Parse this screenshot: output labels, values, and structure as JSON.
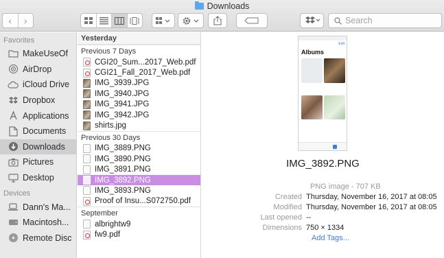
{
  "window": {
    "title": "Downloads"
  },
  "toolbar": {
    "back_icon": "chevron-left-icon",
    "forward_icon": "chevron-right-icon",
    "views": [
      "icon-view",
      "list-view",
      "column-view",
      "cover-flow-view"
    ],
    "active_view": "column-view",
    "search_placeholder": "Search"
  },
  "sidebar": {
    "favorites_heading": "Favorites",
    "favorites": [
      {
        "label": "MakeUseOf",
        "icon": "folder-icon"
      },
      {
        "label": "AirDrop",
        "icon": "airdrop-icon"
      },
      {
        "label": "iCloud Drive",
        "icon": "cloud-icon"
      },
      {
        "label": "Dropbox",
        "icon": "dropbox-icon"
      },
      {
        "label": "Applications",
        "icon": "applications-icon"
      },
      {
        "label": "Documents",
        "icon": "documents-icon"
      },
      {
        "label": "Downloads",
        "icon": "downloads-icon",
        "selected": true
      },
      {
        "label": "Pictures",
        "icon": "camera-icon"
      },
      {
        "label": "Desktop",
        "icon": "desktop-icon"
      }
    ],
    "devices_heading": "Devices",
    "devices": [
      {
        "label": "Dann's Ma...",
        "icon": "laptop-icon"
      },
      {
        "label": "Macintosh...",
        "icon": "disk-icon"
      },
      {
        "label": "Remote Disc",
        "icon": "disc-icon"
      }
    ]
  },
  "list": {
    "groups": [
      {
        "title": "Yesterday",
        "items": []
      },
      {
        "title": "Previous 7 Days",
        "items": [
          {
            "name": "CGI20_Sum...2017_Web.pdf",
            "kind": "pdf"
          },
          {
            "name": "CGI21_Fall_2017_Web.pdf",
            "kind": "pdf"
          },
          {
            "name": "IMG_3939.JPG",
            "kind": "img"
          },
          {
            "name": "IMG_3940.JPG",
            "kind": "img"
          },
          {
            "name": "IMG_3941.JPG",
            "kind": "img"
          },
          {
            "name": "IMG_3942.JPG",
            "kind": "img"
          },
          {
            "name": "shirts.jpg",
            "kind": "img"
          }
        ]
      },
      {
        "title": "Previous 30 Days",
        "items": [
          {
            "name": "IMG_3889.PNG",
            "kind": "doc"
          },
          {
            "name": "IMG_3890.PNG",
            "kind": "doc"
          },
          {
            "name": "IMG_3891.PNG",
            "kind": "doc"
          },
          {
            "name": "IMG_3892.PNG",
            "kind": "doc",
            "selected": true
          },
          {
            "name": "IMG_3893.PNG",
            "kind": "doc"
          },
          {
            "name": "Proof of Insu...S072750.pdf",
            "kind": "pdf"
          }
        ]
      },
      {
        "title": "September",
        "items": [
          {
            "name": "albrightw9",
            "kind": "doc"
          },
          {
            "name": "fw9.pdf",
            "kind": "pdf"
          }
        ]
      }
    ]
  },
  "preview": {
    "thumbnail_title": "Albums",
    "file_name": "IMG_3892.PNG",
    "kind": "PNG image - 707 KB",
    "rows": [
      {
        "label": "Created",
        "value": "Thursday, November 16, 2017 at 08:05"
      },
      {
        "label": "Modified",
        "value": "Thursday, November 16, 2017 at 08:05"
      },
      {
        "label": "Last opened",
        "value": "--"
      },
      {
        "label": "Dimensions",
        "value": "750 × 1334"
      }
    ],
    "add_tags": "Add Tags..."
  },
  "colors": {
    "selection": "#c98ee3",
    "link": "#3d7be6",
    "sidebar_selected": "#cfcfd2"
  }
}
